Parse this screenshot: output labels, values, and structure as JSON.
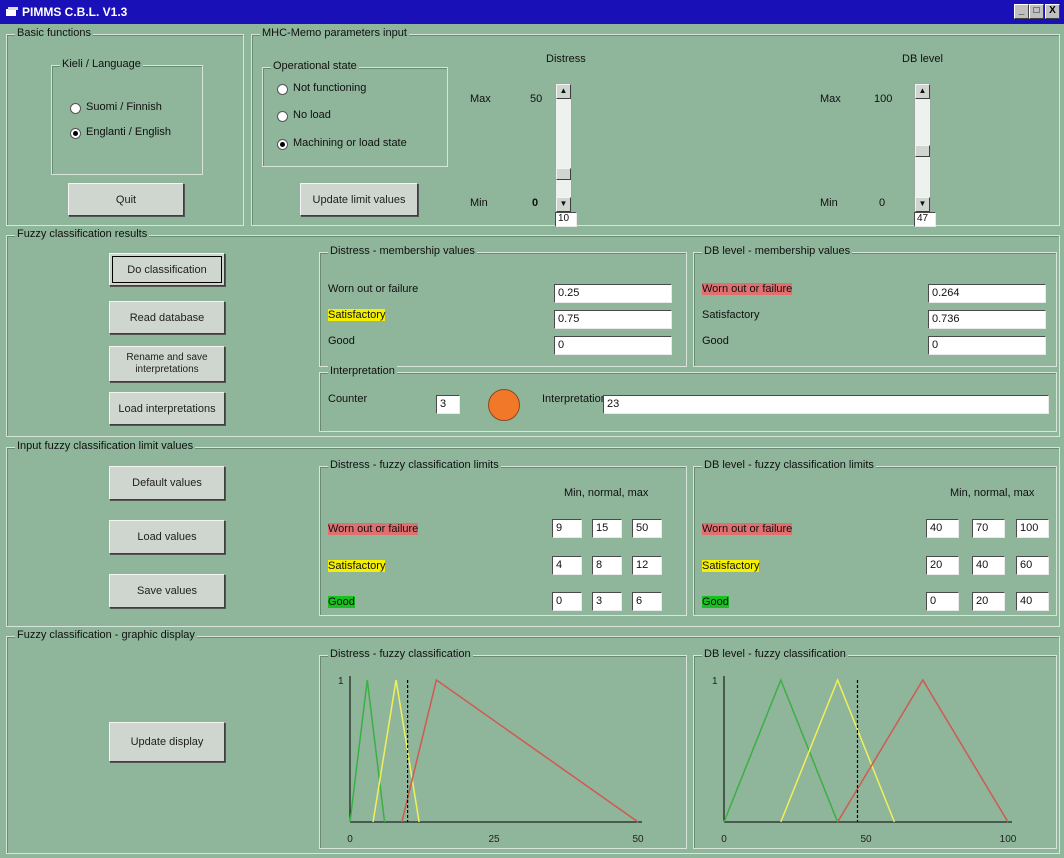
{
  "window": {
    "title": "PIMMS C.B.L. V1.3",
    "minimize": "_",
    "maximize": "□",
    "close": "X"
  },
  "basic": {
    "title": "Basic functions",
    "lang_title": "Kieli / Language",
    "finnish": "Suomi / Finnish",
    "english": "Englanti / English",
    "selected": "english",
    "quit": "Quit"
  },
  "params": {
    "title": "MHC-Memo parameters input",
    "op_title": "Operational state",
    "states": [
      "Not functioning",
      "No load",
      "Machining or load state"
    ],
    "selected_state": 2,
    "update_btn": "Update limit values",
    "distress": {
      "label": "Distress",
      "max_label": "Max",
      "max": "50",
      "min_label": "Min",
      "min": "0",
      "value": "10",
      "fraction": 0.2
    },
    "db": {
      "label": "DB level",
      "max_label": "Max",
      "max": "100",
      "min_label": "Min",
      "min": "0",
      "value": "47",
      "fraction": 0.47
    }
  },
  "results": {
    "title": "Fuzzy classification results",
    "buttons": {
      "classify": "Do classification",
      "read_db": "Read database",
      "rename": "Rename and save interpretations",
      "load_interp": "Load interpretations"
    },
    "distress": {
      "title": "Distress - membership values",
      "rows": [
        {
          "label": "Worn out or failure",
          "value": "0.25"
        },
        {
          "label": "Satisfactory",
          "value": "0.75"
        },
        {
          "label": "Good",
          "value": "0"
        }
      ]
    },
    "db": {
      "title": "DB level - membership values",
      "rows": [
        {
          "label": "Worn out or failure",
          "value": "0.264"
        },
        {
          "label": "Satisfactory",
          "value": "0.736"
        },
        {
          "label": "Good",
          "value": "0"
        }
      ]
    },
    "interp": {
      "title": "Interpretation",
      "counter_label": "Counter",
      "counter": "3",
      "label": "Interpretation",
      "value": "23",
      "indicator_color": "#f07828"
    }
  },
  "limits": {
    "title": "Input fuzzy classification limit values",
    "buttons": {
      "default": "Default values",
      "load": "Load values",
      "save": "Save values"
    },
    "distress": {
      "title": "Distress - fuzzy classification limits",
      "header": "Min, normal, max",
      "rows": [
        {
          "label": "Worn out or failure",
          "values": [
            "9",
            "15",
            "50"
          ]
        },
        {
          "label": "Satisfactory",
          "values": [
            "4",
            "8",
            "12"
          ]
        },
        {
          "label": "Good",
          "values": [
            "0",
            "3",
            "6"
          ]
        }
      ]
    },
    "db": {
      "title": "DB level - fuzzy classification limits",
      "header": "Min, normal, max",
      "rows": [
        {
          "label": "Worn out or failure",
          "values": [
            "40",
            "70",
            "100"
          ]
        },
        {
          "label": "Satisfactory",
          "values": [
            "20",
            "40",
            "60"
          ]
        },
        {
          "label": "Good",
          "values": [
            "0",
            "20",
            "40"
          ]
        }
      ]
    }
  },
  "graphic": {
    "title": "Fuzzy classification - graphic display",
    "update": "Update display"
  },
  "chart_data": [
    {
      "type": "line",
      "title": "Distress - fuzzy classification",
      "y_tick": "1",
      "x_ticks": [
        "0",
        "25",
        "50"
      ],
      "xlim": [
        0,
        50
      ],
      "ylim": [
        0,
        1
      ],
      "marker_x": 10,
      "series": [
        {
          "x": [
            0,
            3,
            6
          ],
          "y": [
            0,
            1,
            0
          ],
          "color": "#3cb043"
        },
        {
          "x": [
            4,
            8,
            12
          ],
          "y": [
            0,
            1,
            0
          ],
          "color": "#f2f05a"
        },
        {
          "x": [
            9,
            15,
            50
          ],
          "y": [
            0,
            1,
            0
          ],
          "color": "#d05a50"
        }
      ]
    },
    {
      "type": "line",
      "title": "DB level - fuzzy classification",
      "y_tick": "1",
      "x_ticks": [
        "0",
        "50",
        "100"
      ],
      "xlim": [
        0,
        100
      ],
      "ylim": [
        0,
        1
      ],
      "marker_x": 47,
      "series": [
        {
          "x": [
            0,
            20,
            40
          ],
          "y": [
            0,
            1,
            0
          ],
          "color": "#3cb043"
        },
        {
          "x": [
            20,
            40,
            60
          ],
          "y": [
            0,
            1,
            0
          ],
          "color": "#f2f05a"
        },
        {
          "x": [
            40,
            70,
            100
          ],
          "y": [
            0,
            1,
            0
          ],
          "color": "#d05a50"
        }
      ]
    }
  ]
}
